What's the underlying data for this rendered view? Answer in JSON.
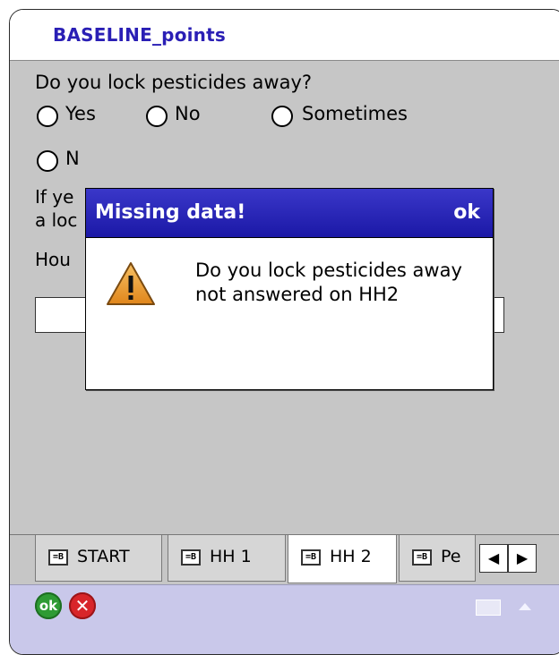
{
  "app": {
    "title": "BASELINE_points"
  },
  "form": {
    "question1": "Do you lock pesticides away?",
    "options": [
      "Yes",
      "No",
      "Sometimes"
    ],
    "option4_partial": "N",
    "question2_line1_partial": "If ye",
    "question2_line2_partial": "a loc",
    "question3_partial": "Hou"
  },
  "dialog": {
    "title": "Missing data!",
    "ok_label": "ok",
    "message": "Do you lock pesticides away not answered on HH2",
    "icon": "warning-icon"
  },
  "tabs": [
    {
      "label": "START",
      "active": false
    },
    {
      "label": "HH 1",
      "active": false
    },
    {
      "label": "HH 2",
      "active": true
    },
    {
      "label": "Pe",
      "active": false
    }
  ],
  "bottom": {
    "ok_label": "ok",
    "cancel_icon": "close-icon",
    "keyboard_icon": "keyboard-icon"
  },
  "colors": {
    "title": "#2a1fb5",
    "dialog_header": "#1b18a6",
    "form_bg": "#c6c6c6",
    "bottom_bar": "#c9c8ea"
  }
}
